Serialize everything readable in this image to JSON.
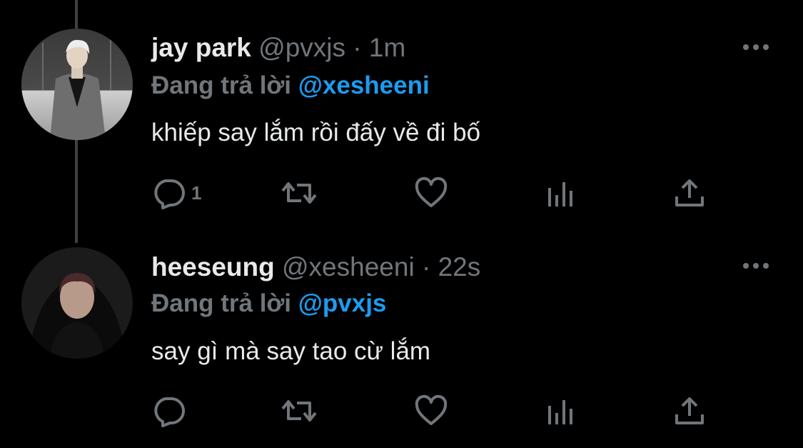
{
  "colors": {
    "background": "#000000",
    "primary_text": "#e7e9ea",
    "secondary_text": "#71767b",
    "accent": "#1d9bf0",
    "thread_line": "#3e4144"
  },
  "tweets": [
    {
      "display_name": "jay park",
      "handle": "@pvxjs",
      "separator": "·",
      "time": "1m",
      "reply_prefix": "Đang trả lời",
      "reply_to": "@xesheeni",
      "text": "khiếp say lắm rồi đấy về đi bố",
      "reply_count": "1",
      "icons": [
        "reply-icon",
        "retweet-icon",
        "like-icon",
        "analytics-icon",
        "share-icon",
        "more-icon"
      ]
    },
    {
      "display_name": "heeseung",
      "handle": "@xesheeni",
      "separator": "·",
      "time": "22s",
      "reply_prefix": "Đang trả lời",
      "reply_to": "@pvxjs",
      "text": "say gì mà say tao cừ lắm",
      "reply_count": "",
      "icons": [
        "reply-icon",
        "retweet-icon",
        "like-icon",
        "analytics-icon",
        "share-icon",
        "more-icon"
      ]
    }
  ]
}
